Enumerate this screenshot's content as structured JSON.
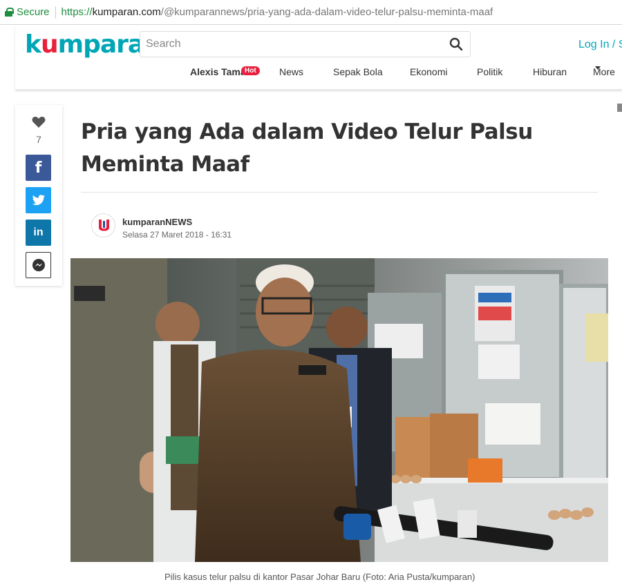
{
  "browser": {
    "secure_label": "Secure",
    "url_scheme": "https://",
    "url_host": "kumparan.com",
    "url_path": "/@kumparannews/pria-yang-ada-dalam-video-telur-palsu-meminta-maaf"
  },
  "header": {
    "logo": {
      "left": "k",
      "accent": "u",
      "right": "mparan"
    },
    "search_placeholder": "Search",
    "login_label": "Log In / S",
    "nav": {
      "featured": "Alexis Tamat",
      "hot_badge": "Hot",
      "items": [
        "News",
        "Sepak Bola",
        "Ekonomi",
        "Politik",
        "Hiburan"
      ],
      "more": "More"
    }
  },
  "share": {
    "like_count": "7",
    "facebook_icon": "f",
    "linkedin_icon": "in"
  },
  "article": {
    "title": "Pria yang Ada dalam Video Telur Palsu Meminta Maaf",
    "author": "kumparanNEWS",
    "date": "Selasa 27 Maret 2018 - 16:31",
    "caption": "Pilis kasus telur palsu di kantor Pasar Johar Baru (Foto: Aria Pusta/kumparan)"
  },
  "colors": {
    "brand_teal": "#00a6b6",
    "brand_red": "#e8203c",
    "facebook": "#3b5998",
    "twitter": "#1da1f2",
    "linkedin": "#0e76a8"
  },
  "icons": [
    "lock-icon",
    "search-icon",
    "heart-icon",
    "facebook-icon",
    "twitter-icon",
    "linkedin-icon",
    "messenger-icon",
    "chevron-down-icon"
  ]
}
